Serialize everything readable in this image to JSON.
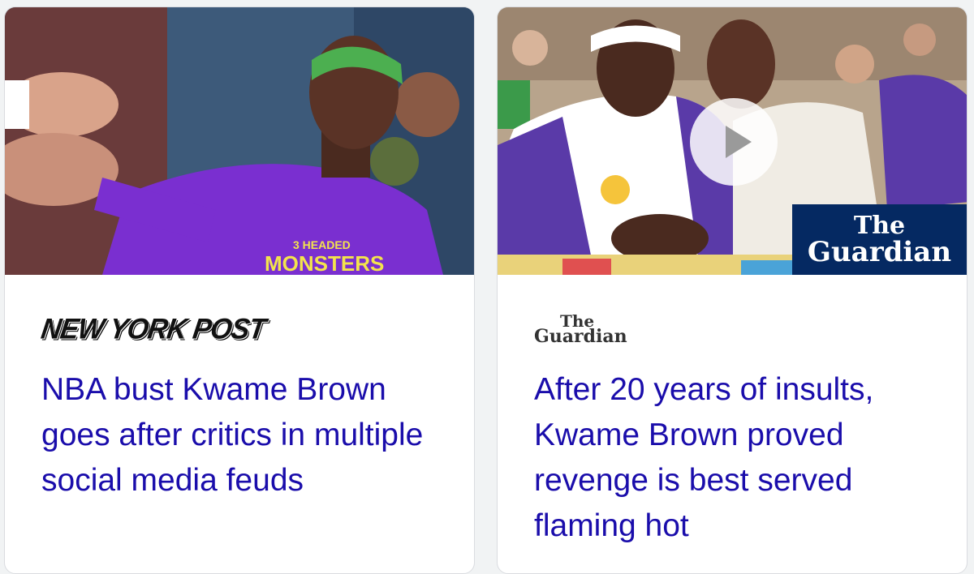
{
  "cards": [
    {
      "source": "NEW YORK POST",
      "headline": "NBA bust Kwame Brown goes after critics in multiple social media feuds",
      "jersey_text_top": "3 HEADED",
      "jersey_text_bottom": "MONSTERS"
    },
    {
      "source_line1": "The",
      "source_line2": "Guardian",
      "headline": "After 20 years of insults, Kwame Brown proved revenge is best served flaming hot",
      "badge_line1": "The",
      "badge_line2": "Guardian",
      "has_video": true
    }
  ],
  "colors": {
    "headline": "#1a0dab",
    "guardian_blue": "#052962",
    "jersey_purple": "#7a2fd0",
    "lakers_purple": "#5a3aa8"
  }
}
